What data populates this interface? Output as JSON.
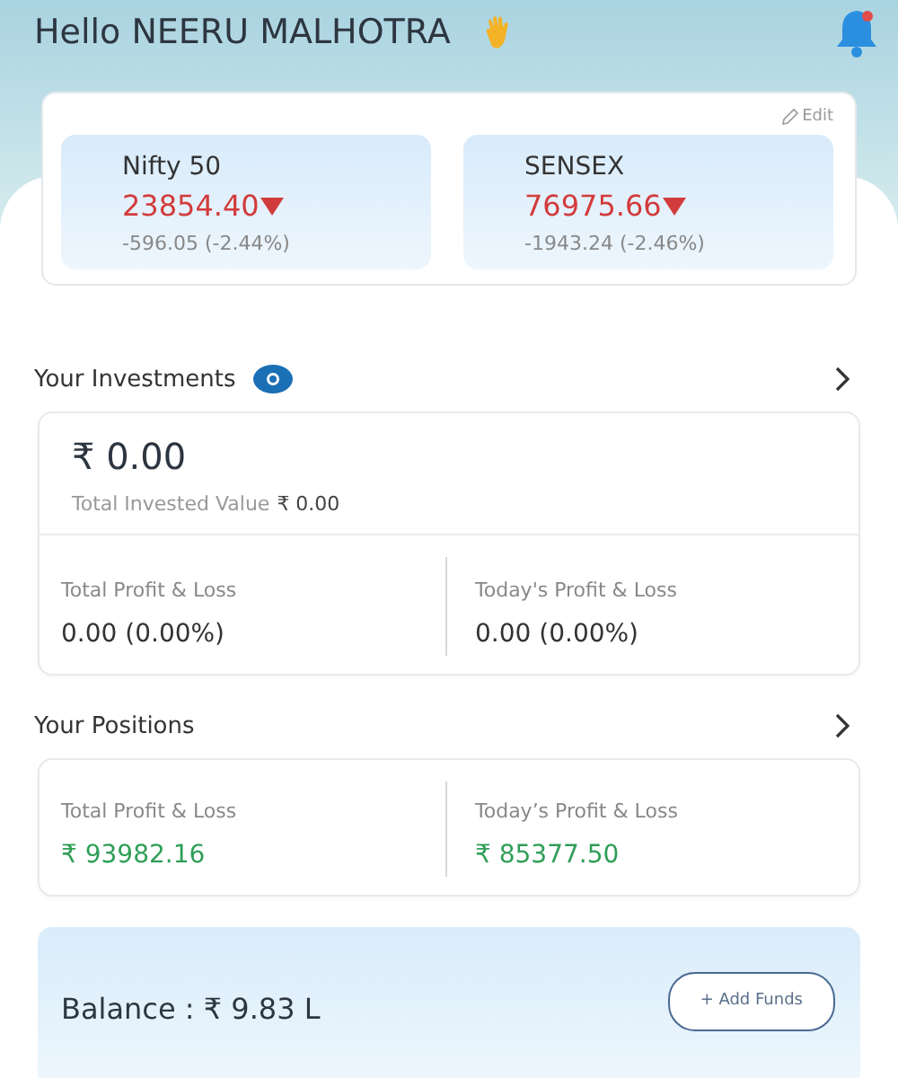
{
  "greeting": {
    "text": "Hello NEERU MALHOTRA",
    "notification_dot": true
  },
  "indices": {
    "edit_label": "Edit",
    "items": [
      {
        "name": "Nifty 50",
        "value": "23854.40",
        "falling": true,
        "change": "-596.05 (-2.44%)"
      },
      {
        "name": "SENSEX",
        "value": "76975.66",
        "falling": true,
        "change": "-1943.24 (-2.46%)"
      }
    ]
  },
  "investments": {
    "title": "Your Investments",
    "current_value": "₹ 0.00",
    "invested_label": "Total Invested Value",
    "invested_value": "₹ 0.00",
    "metrics": [
      {
        "label": "Total Profit & Loss",
        "value": "0.00 (0.00%)",
        "gain": false
      },
      {
        "label": "Today's Profit & Loss",
        "value": "0.00 (0.00%)",
        "gain": false
      }
    ]
  },
  "positions": {
    "title": "Your Positions",
    "metrics": [
      {
        "label": "Total Profit & Loss",
        "value": "₹ 93982.16",
        "gain": true
      },
      {
        "label": "Today’s Profit & Loss",
        "value": "₹ 85377.50",
        "gain": true
      }
    ]
  },
  "balance": {
    "text": "Balance : ₹ 9.83 L",
    "button": "+ Add Funds"
  }
}
